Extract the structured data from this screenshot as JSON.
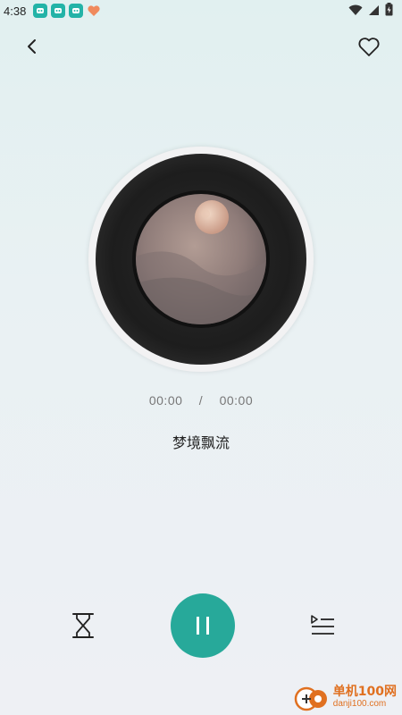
{
  "status_bar": {
    "time": "4:38",
    "notification_icons": [
      "app-notification-icon",
      "app-notification-icon",
      "app-notification-icon",
      "heart-app-icon"
    ],
    "system_icons": [
      "wifi-icon",
      "cellular-signal-icon",
      "battery-charging-icon"
    ]
  },
  "header": {
    "back_icon": "chevron-left-icon",
    "favorite_icon": "heart-outline-icon"
  },
  "player": {
    "current_time": "00:00",
    "separator": "/",
    "total_time": "00:00",
    "song_title": "梦境飘流",
    "state": "playing"
  },
  "controls": {
    "timer_icon": "hourglass-icon",
    "play_pause_icon": "pause-icon",
    "playlist_icon": "playlist-icon"
  },
  "watermark": {
    "main": "单机100网",
    "sub": "danji100.com"
  },
  "colors": {
    "accent": "#27a99a",
    "status_teal": "#23b3a7"
  }
}
